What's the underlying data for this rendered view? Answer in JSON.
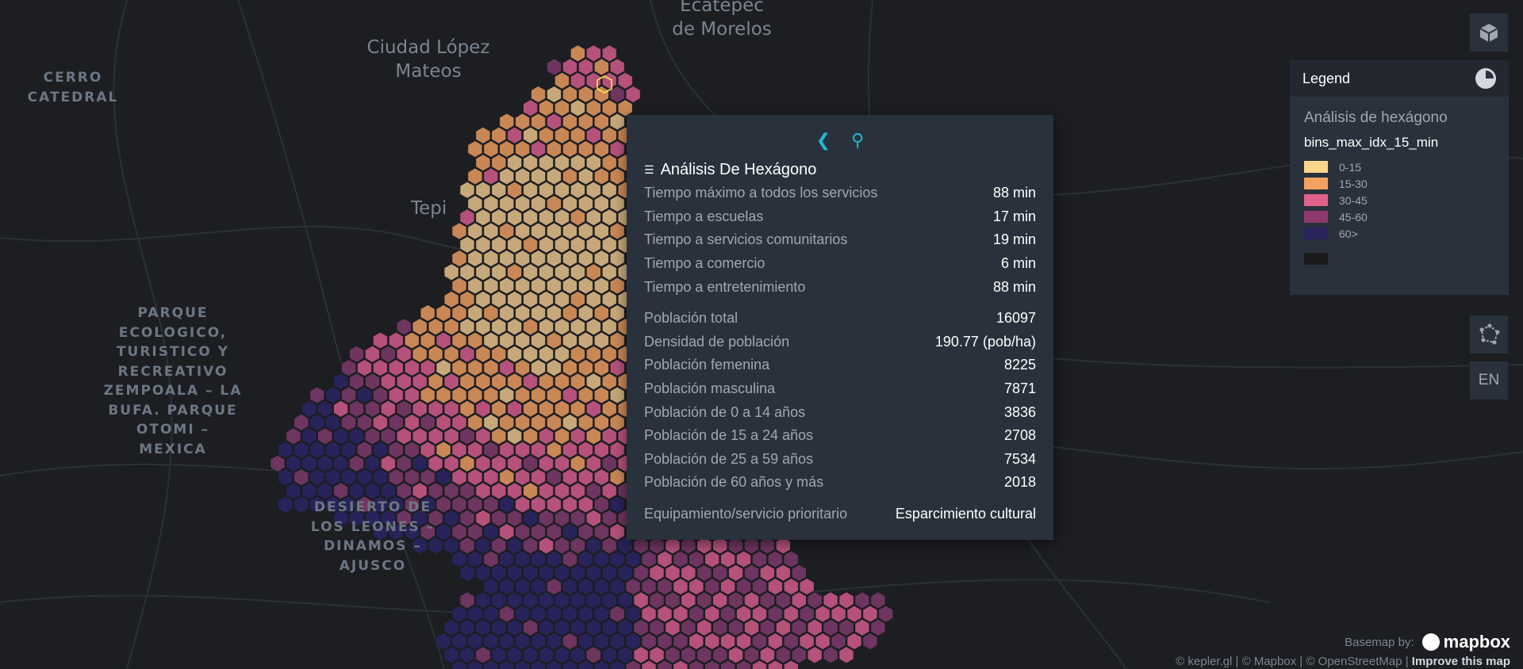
{
  "map": {
    "places": [
      {
        "name": "CERRO\nCATEDRAL",
        "kind": "area"
      },
      {
        "name": "Ciudad López\nMateos",
        "kind": "city"
      },
      {
        "name": "Ecatepec\nde Morelos",
        "kind": "city"
      },
      {
        "name": "PARQUE\nECOLOGICO,\nTURISTICO Y\nRECREATIVO\nZEMPOALA – LA\nBUFA. PARQUE\nOTOMI –\nMEXICA",
        "kind": "area"
      },
      {
        "name": "DESIERTO DE\nLOS LEONES –\nDINAMOS –\nAJUSCO",
        "kind": "area"
      },
      {
        "name": "Tepi",
        "kind": "city"
      }
    ]
  },
  "tooltip": {
    "title": "Análisis De Hexágono",
    "rows": [
      {
        "label": "Tiempo máximo a todos los servicios",
        "value": "88 min"
      },
      {
        "label": "Tiempo a escuelas",
        "value": "17 min"
      },
      {
        "label": "Tiempo a servicios comunitarios",
        "value": "19 min"
      },
      {
        "label": "Tiempo a comercio",
        "value": "6 min"
      },
      {
        "label": "Tiempo a entretenimiento",
        "value": "88 min"
      }
    ],
    "population_rows": [
      {
        "label": "Población total",
        "value": "16097"
      },
      {
        "label": "Densidad de población",
        "value": "190.77 (pob/ha)"
      },
      {
        "label": "Población femenina",
        "value": "8225"
      },
      {
        "label": "Población masculina",
        "value": "7871"
      },
      {
        "label": "Población de 0 a 14 años",
        "value": "3836"
      },
      {
        "label": "Población de 15 a 24 años",
        "value": "2708"
      },
      {
        "label": "Población de 25 a 59 años",
        "value": "7534"
      },
      {
        "label": "Población de 60 años y más",
        "value": "2018"
      }
    ],
    "priority": {
      "label": "Equipamiento/servicio prioritario",
      "value": "Esparcimiento cultural"
    }
  },
  "legend": {
    "header": "Legend",
    "layer_name": "Análisis de hexágono",
    "field": "bins_max_idx_15_min",
    "items": [
      {
        "label": "0-15",
        "color": "#fdd68b"
      },
      {
        "label": "15-30",
        "color": "#f4a261"
      },
      {
        "label": "30-45",
        "color": "#e0618a"
      },
      {
        "label": "45-60",
        "color": "#8e3a6e"
      },
      {
        "label": "60>",
        "color": "#2a235c"
      }
    ]
  },
  "controls": {
    "language": "EN"
  },
  "attribution": {
    "basemap_by": "Basemap by:",
    "mapbox": "mapbox",
    "text": "© kepler.gl | © Mapbox | © OpenStreetMap |",
    "improve": "Improve this map"
  }
}
